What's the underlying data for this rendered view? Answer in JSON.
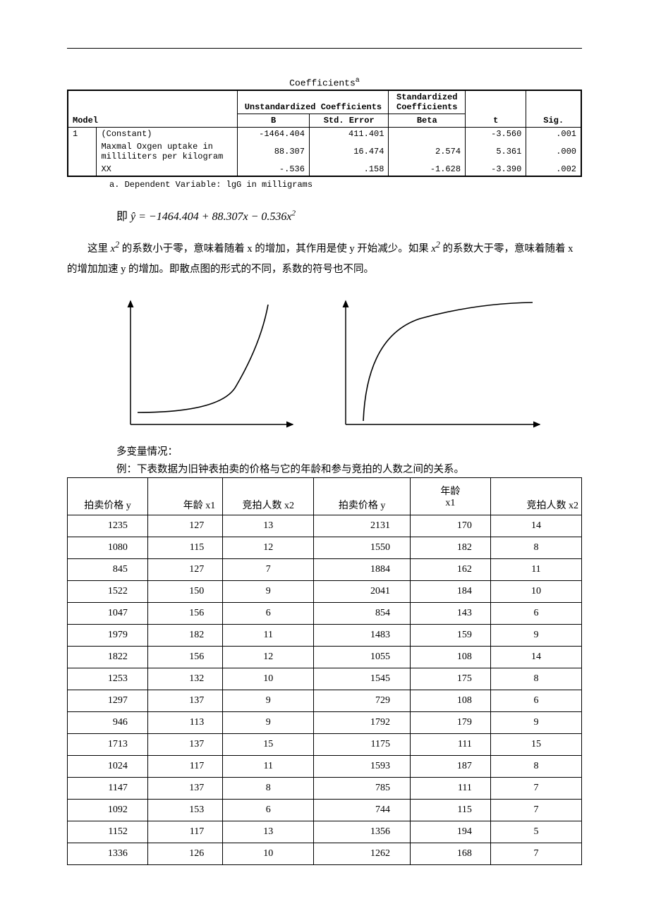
{
  "coef_table": {
    "title": "Coefficients",
    "super": "a",
    "header_unstd": "Unstandardized Coefficients",
    "header_std": "Standardized Coefficients",
    "h_model": "Model",
    "h_b": "B",
    "h_se": "Std. Error",
    "h_beta": "Beta",
    "h_t": "t",
    "h_sig": "Sig.",
    "model_no": "1",
    "rows": [
      {
        "label": "(Constant)",
        "b": "-1464.404",
        "se": "411.401",
        "beta": "",
        "t": "-3.560",
        "sig": ".001"
      },
      {
        "label": "Maxmal Oxgen uptake in milliliters per kilogram",
        "b": "88.307",
        "se": "16.474",
        "beta": "2.574",
        "t": "5.361",
        "sig": ".000"
      },
      {
        "label": "XX",
        "b": "-.536",
        "se": ".158",
        "beta": "-1.628",
        "t": "-3.390",
        "sig": ".002"
      }
    ],
    "note": "a. Dependent Variable: lgG in milligrams"
  },
  "formula_prefix": "即 ",
  "formula_yhat": "ŷ = −1464.404 + 88.307x − 0.536x",
  "formula_sup": "2",
  "para1_a": "这里 ",
  "para1_x2": "x",
  "para1_b": " 的系数小于零，意味着随着 x 的增加，其作用是使 y 开始减少。如果 ",
  "para1_c": " 的系数大于零，意味着随着 x 的增加加速 y 的增加。即散点图的形式的不同，系数的符号也不同。",
  "multi_heading": "多变量情况：",
  "example_line": "例：下表数据为旧钟表拍卖的价格与它的年龄和参与竞拍的人数之间的关系。",
  "data_table": {
    "headers": [
      "拍卖价格 y",
      "年龄 x1",
      "竞拍人数 x2",
      "拍卖价格 y",
      "年龄 x1",
      "竞拍人数 x2"
    ],
    "rows": [
      [
        "1235",
        "127",
        "13",
        "2131",
        "170",
        "14"
      ],
      [
        "1080",
        "115",
        "12",
        "1550",
        "182",
        "8"
      ],
      [
        "845",
        "127",
        "7",
        "1884",
        "162",
        "11"
      ],
      [
        "1522",
        "150",
        "9",
        "2041",
        "184",
        "10"
      ],
      [
        "1047",
        "156",
        "6",
        "854",
        "143",
        "6"
      ],
      [
        "1979",
        "182",
        "11",
        "1483",
        "159",
        "9"
      ],
      [
        "1822",
        "156",
        "12",
        "1055",
        "108",
        "14"
      ],
      [
        "1253",
        "132",
        "10",
        "1545",
        "175",
        "8"
      ],
      [
        "1297",
        "137",
        "9",
        "729",
        "108",
        "6"
      ],
      [
        "946",
        "113",
        "9",
        "1792",
        "179",
        "9"
      ],
      [
        "1713",
        "137",
        "15",
        "1175",
        "111",
        "15"
      ],
      [
        "1024",
        "117",
        "11",
        "1593",
        "187",
        "8"
      ],
      [
        "1147",
        "137",
        "8",
        "785",
        "111",
        "7"
      ],
      [
        "1092",
        "153",
        "6",
        "744",
        "115",
        "7"
      ],
      [
        "1152",
        "117",
        "13",
        "1356",
        "194",
        "5"
      ],
      [
        "1336",
        "126",
        "10",
        "1262",
        "168",
        "7"
      ]
    ]
  }
}
